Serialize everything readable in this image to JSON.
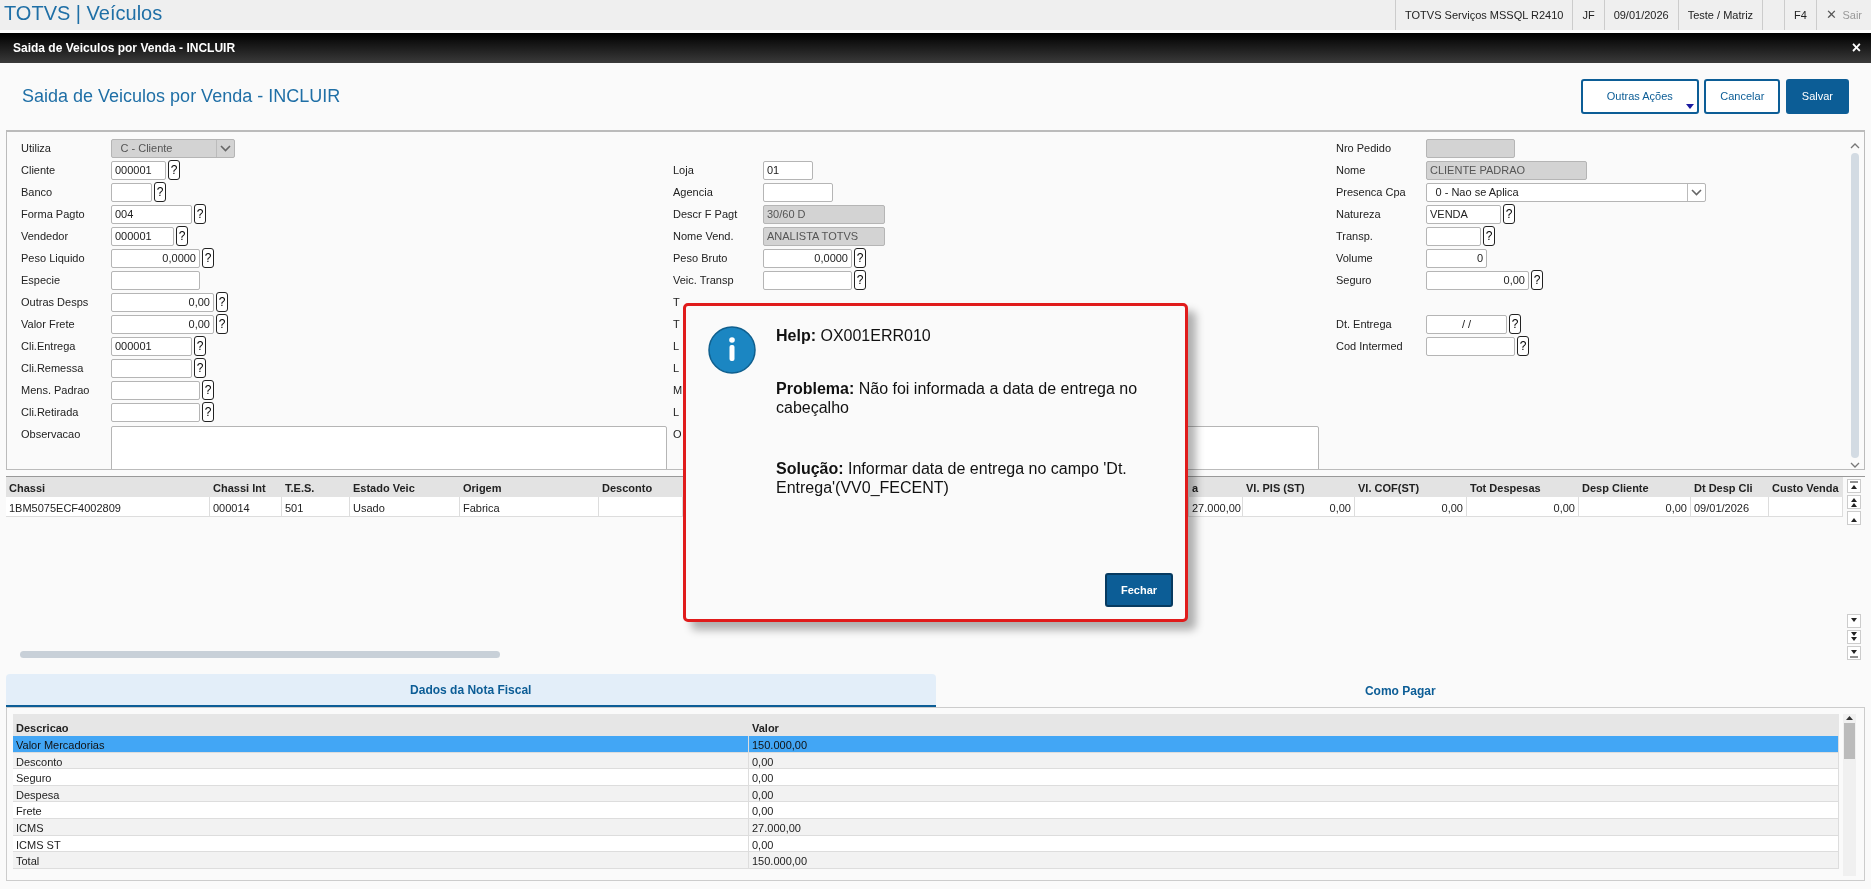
{
  "app": {
    "title": "TOTVS | Veículos",
    "status_items": [
      "TOTVS Serviços MSSQL R2410",
      "JF",
      "09/01/2026",
      "Teste / Matriz",
      "F4"
    ],
    "exit": {
      "icon": "✕",
      "label": "Sair",
      "disabled": true
    }
  },
  "window": {
    "title": "Saida de Veiculos por Venda - INCLUIR",
    "close": "×"
  },
  "page": {
    "title": "Saida de Veiculos por Venda - INCLUIR",
    "actions": [
      {
        "label": "Outras Ações",
        "kind": "menu"
      },
      {
        "label": "Cancelar",
        "kind": "secondary"
      },
      {
        "label": "Salvar",
        "kind": "primary"
      }
    ]
  },
  "form": {
    "columns": [
      {
        "fields": [
          {
            "label": "Utiliza",
            "kind": "select",
            "value": "C - Cliente",
            "disabled": true
          },
          {
            "label": "Cliente",
            "kind": "text",
            "value": "000001",
            "help": "?",
            "disabled": false
          },
          {
            "label": "Banco",
            "kind": "text",
            "help": "?",
            "disabled": false
          },
          {
            "label": "Forma Pagto",
            "kind": "text",
            "value": "004",
            "help": "?",
            "disabled": false
          },
          {
            "label": "Vendedor",
            "kind": "text",
            "value": "000001",
            "help": "?",
            "disabled": false
          },
          {
            "label": "Peso Liquido",
            "kind": "text",
            "value": "0,0000",
            "help": "?",
            "disabled": false
          },
          {
            "label": "Especie",
            "kind": "text",
            "disabled": false
          },
          {
            "label": "Outras Desps",
            "kind": "text",
            "value": "0,00",
            "help": "?",
            "disabled": false
          },
          {
            "label": "Valor Frete",
            "kind": "text",
            "value": "0,00",
            "help": "?",
            "disabled": false
          },
          {
            "label": "Cli.Entrega",
            "kind": "text",
            "value": "000001",
            "help": "?",
            "disabled": false
          },
          {
            "label": "Cli.Remessa",
            "kind": "text",
            "help": "?",
            "disabled": false
          },
          {
            "label": "Mens. Padrao",
            "kind": "text",
            "help": "?",
            "disabled": false
          },
          {
            "label": "Cli.Retirada",
            "kind": "text",
            "help": "?",
            "disabled": false
          },
          {
            "label": "Observacao",
            "kind": "memo",
            "disabled": false
          }
        ]
      },
      {
        "fields": [
          {
            "label": "Loja",
            "kind": "text",
            "value": "01",
            "disabled": false
          },
          {
            "label": "Agencia",
            "kind": "text",
            "disabled": false
          },
          {
            "label": "Descr F Pagt",
            "kind": "text",
            "value": "30/60 D",
            "disabled": true
          },
          {
            "label": "Nome Vend.",
            "kind": "text",
            "value": "ANALISTA TOTVS",
            "disabled": true
          },
          {
            "label": "Peso Bruto",
            "kind": "text",
            "value": "0,0000",
            "help": "?",
            "disabled": false
          },
          {
            "label": "Veic. Transp",
            "kind": "text",
            "help": "?",
            "disabled": false
          },
          {
            "label": "T",
            "kind": "label"
          },
          {
            "label": "T",
            "kind": "label"
          },
          {
            "label": "L",
            "kind": "label"
          },
          {
            "label": "L",
            "kind": "label"
          },
          {
            "label": "M",
            "kind": "label"
          },
          {
            "label": "L",
            "kind": "label"
          },
          {
            "label": "O",
            "kind": "memo",
            "disabled": false
          }
        ]
      },
      {
        "fields": [
          {
            "label": "Nro Pedido",
            "kind": "text",
            "disabled": true
          },
          {
            "label": "Nome",
            "kind": "text",
            "value": "CLIENTE PADRAO",
            "disabled": true
          },
          {
            "label": "Presenca Cpa",
            "kind": "select",
            "value": "0 - Nao se Aplica",
            "disabled": false
          },
          {
            "label": "Natureza",
            "kind": "text",
            "value": "VENDA",
            "help": "?",
            "disabled": false
          },
          {
            "label": "Transp.",
            "kind": "text",
            "help": "?",
            "disabled": false
          },
          {
            "label": "Volume",
            "kind": "text",
            "value": "0",
            "disabled": false
          },
          {
            "label": "Seguro",
            "kind": "text",
            "value": "0,00",
            "help": "?",
            "disabled": false
          },
          {
            "label": "Dt. Entrega",
            "kind": "text",
            "value": "/  /",
            "help": "?",
            "disabled": false
          },
          {
            "label": "Cod Intermed",
            "kind": "text",
            "help": "?",
            "disabled": false
          }
        ]
      }
    ]
  },
  "grid": {
    "columns": [
      "Chassi",
      "Chassi Int",
      "T.E.S.",
      "Estado Veic",
      "Origem",
      "Desconto",
      "a",
      "VI. PIS (ST)",
      "VI. COF(ST)",
      "Tot Despesas",
      "Desp Cliente",
      "Dt Desp Cli",
      "Custo Venda"
    ],
    "rows": [
      {
        "cells": [
          "1BM5075ECF4002809",
          "000014",
          "501",
          "Usado",
          "Fabrica",
          "",
          "27.000,00",
          "0,00",
          "0,00",
          "0,00",
          "0,00",
          "09/01/2026",
          ""
        ]
      }
    ]
  },
  "tabs": [
    {
      "label": "Dados da Nota Fiscal",
      "selected": true
    },
    {
      "label": "Como Pagar",
      "selected": false
    }
  ],
  "summary": {
    "columns": [
      "Descricao",
      "Valor"
    ],
    "rows": [
      {
        "cells": [
          "Valor Mercadorias",
          "150.000,00"
        ],
        "selected": true
      },
      {
        "cells": [
          "Desconto",
          "0,00"
        ],
        "selected": false
      },
      {
        "cells": [
          "Seguro",
          "0,00"
        ],
        "selected": false
      },
      {
        "cells": [
          "Despesa",
          "0,00"
        ],
        "selected": false
      },
      {
        "cells": [
          "Frete",
          "0,00"
        ],
        "selected": false
      },
      {
        "cells": [
          "ICMS",
          "27.000,00"
        ],
        "selected": false
      },
      {
        "cells": [
          "ICMS ST",
          "0,00"
        ],
        "selected": false
      },
      {
        "cells": [
          "Total",
          "150.000,00"
        ],
        "selected": false
      }
    ]
  },
  "dialog": {
    "help": "**Help:** OX001ERR010",
    "problem": "**Problema:** Não foi informada a data de entrega no cabeçalho",
    "solution": "**Solução:** Informar data de entrega no campo 'Dt. Entrega'(VV0_FECENT)",
    "button": "Fechar"
  }
}
